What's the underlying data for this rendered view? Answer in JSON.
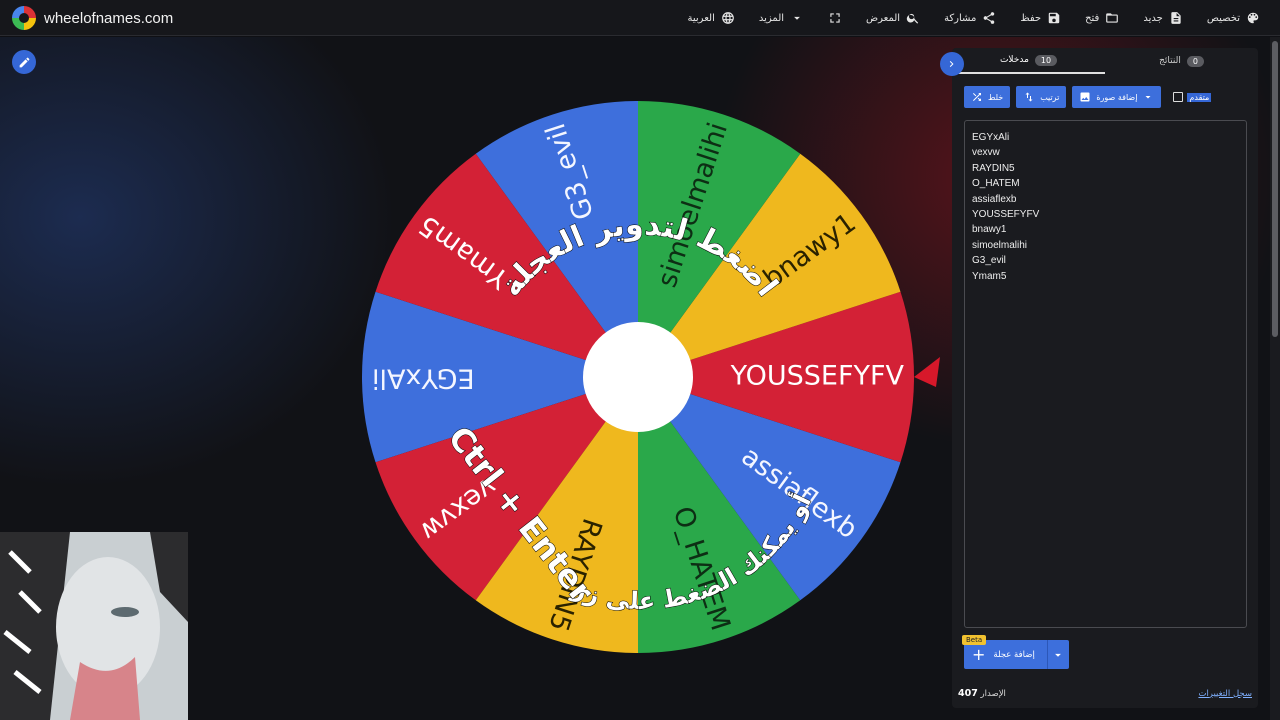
{
  "app": {
    "logo_text": "wheelofnames.com"
  },
  "nav": {
    "language": "العربية",
    "more": "المزيد",
    "gallery": "المعرض",
    "share": "مشاركة",
    "save": "حفظ",
    "open": "فتح",
    "new": "جديد",
    "customize": "تخصيص"
  },
  "wheel": {
    "segments": [
      {
        "name": "EGYxAli",
        "color": "#3e6fdc"
      },
      {
        "name": "vexvw",
        "color": "#d32136"
      },
      {
        "name": "RAYDIN5",
        "color": "#efb81e"
      },
      {
        "name": "O_HATEM",
        "color": "#2aa84a"
      },
      {
        "name": "assiaflexb",
        "color": "#3e6fdc"
      },
      {
        "name": "YOUSSEFYFV",
        "color": "#d32136"
      },
      {
        "name": "bnawy1",
        "color": "#efb81e"
      },
      {
        "name": "simoelmalihi",
        "color": "#2aa84a"
      },
      {
        "name": "G3_evil",
        "color": "#3e6fdc"
      },
      {
        "name": "Ymam5",
        "color": "#d32136"
      }
    ],
    "overlay_top": "اضغط لتدوير العجلة",
    "overlay_bottom": "أو يمكنك الضغط على زر",
    "overlay_keys": "Ctrl + Enter",
    "pointer_color": "#d7182a"
  },
  "panel": {
    "tab_entries": "مدخلات",
    "tab_entries_count": "10",
    "tab_results": "النتائج",
    "tab_results_count": "0",
    "shuffle": "خلط",
    "sort": "ترتيب",
    "add_image": "إضافة صورة",
    "advanced": "متقدم",
    "entries": [
      "EGYxAli",
      "vexvw",
      "RAYDIN5",
      "O_HATEM",
      "assiaflexb",
      "YOUSSEFYFV",
      "bnawy1",
      "simoelmalihi",
      "G3_evil",
      "Ymam5"
    ],
    "beta": "Beta",
    "add_wheel": "إضافة عجلة",
    "version_label": "الإصدار",
    "version_number": "407",
    "changelog": "سجل التغييرات"
  }
}
